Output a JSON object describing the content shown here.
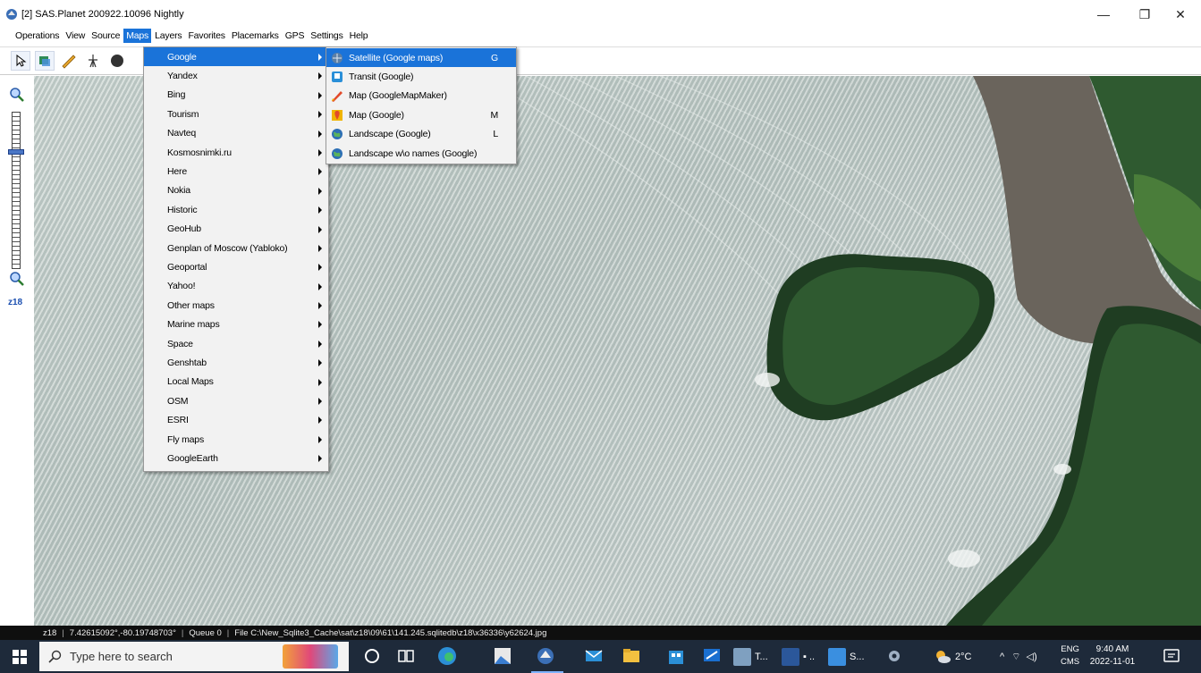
{
  "window": {
    "title": "[2] SAS.Planet 200922.10096 Nightly",
    "controls": {
      "minimize": "—",
      "maximize": "❐",
      "close": "✕"
    }
  },
  "menubar": {
    "items": [
      "Operations",
      "View",
      "Source",
      "Maps",
      "Layers",
      "Favorites",
      "Placemarks",
      "GPS",
      "Settings",
      "Help"
    ],
    "active_index": 3
  },
  "maps_menu": {
    "items": [
      "Google",
      "Yandex",
      "Bing",
      "Tourism",
      "Navteq",
      "Kosmosnimki.ru",
      "Here",
      "Nokia",
      "Historic",
      "GeoHub",
      "Genplan of Moscow (Yabloko)",
      "Geoportal",
      "Yahoo!",
      "Other maps",
      "Marine maps",
      "Space",
      "Genshtab",
      "Local Maps",
      "OSM",
      "ESRI",
      "Fly maps",
      "GoogleEarth"
    ],
    "highlighted_index": 0
  },
  "google_submenu": {
    "items": [
      {
        "label": "Satellite (Google maps)",
        "shortcut": "G",
        "icon": "satellite-icon",
        "color": "#5b7fa6"
      },
      {
        "label": "Transit (Google)",
        "shortcut": "",
        "icon": "transit-icon",
        "color": "#2a8fd8"
      },
      {
        "label": "Map (GoogleMapMaker)",
        "shortcut": "",
        "icon": "mapmaker-icon",
        "color": "#e24a2a"
      },
      {
        "label": "Map (Google)",
        "shortcut": "M",
        "icon": "map-icon",
        "color": "#f0b400"
      },
      {
        "label": "Landscape (Google)",
        "shortcut": "L",
        "icon": "globe-icon",
        "color": "#2d6fb5"
      },
      {
        "label": "Landscape w\\o names (Google)",
        "shortcut": "",
        "icon": "globe-icon",
        "color": "#2d6fb5"
      }
    ],
    "highlighted_index": 0
  },
  "zoom": {
    "label": "z18"
  },
  "statusbar": {
    "zoom": "z18",
    "coords": "7.42615092°,-80.19748703°",
    "queue": "Queue 0",
    "file": "File C:\\New_Sqlite3_Cache\\sat\\z18\\09\\61\\141.245.sqlitedb\\z18\\x36336\\y62624.jpg"
  },
  "taskbar": {
    "search_placeholder": "Type here to search",
    "weather": "2°C",
    "lang_top": "ENG",
    "lang_bottom": "CMS",
    "time": "9:40 AM",
    "date": "2022-11-01",
    "apps": [
      "T...",
      "S..."
    ]
  },
  "colors": {
    "menu_highlight": "#1a73d9",
    "taskbar": "#1e2a3a",
    "forest": "#2f5a30",
    "beach": "#6a645c"
  }
}
